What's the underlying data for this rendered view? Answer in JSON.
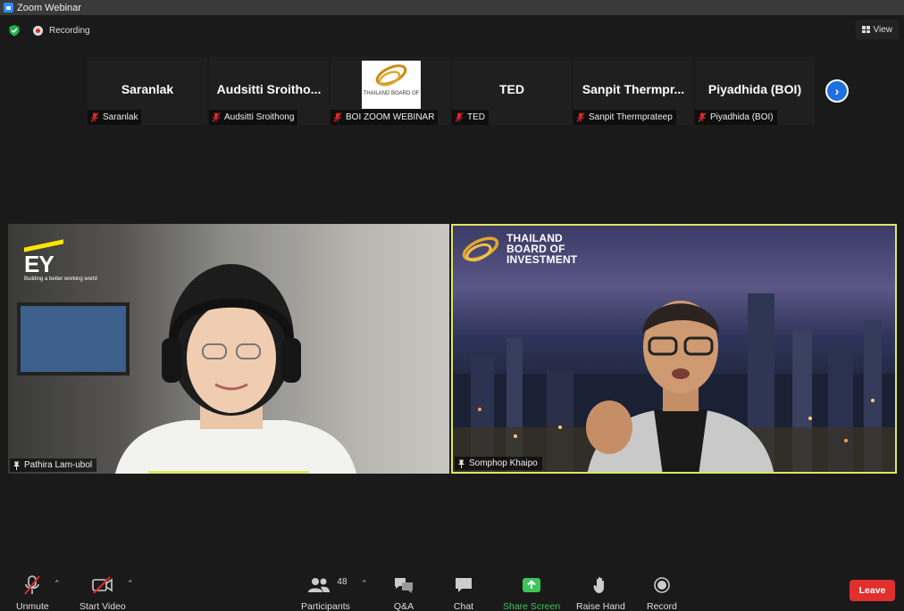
{
  "window": {
    "title": "Zoom Webinar"
  },
  "status": {
    "recording_label": "Recording",
    "view_label": "View"
  },
  "thumbnails": [
    {
      "display": "Saranlak",
      "label": "Saranlak"
    },
    {
      "display": "Audsitti  Sroitho...",
      "label": "Audsitti Sroithong"
    },
    {
      "display": "",
      "label": "BOI ZOOM WEBINAR",
      "logo_text": "THAILAND BOARD OF"
    },
    {
      "display": "TED",
      "label": "TED"
    },
    {
      "display": "Sanpit  Thermpr...",
      "label": "Sanpit Thermprateep"
    },
    {
      "display": "Piyadhida (BOI)",
      "label": "Piyadhida (BOI)"
    }
  ],
  "videos": {
    "left": {
      "name": "Pathira Lam-ubol",
      "ey_text": "EY",
      "ey_tagline": "Building a better working world"
    },
    "right": {
      "name": "Somphop Khaipo",
      "logo_line1": "THAILAND",
      "logo_line2": "BOARD OF",
      "logo_line3": "INVESTMENT"
    }
  },
  "toolbar": {
    "unmute": "Unmute",
    "start_video": "Start Video",
    "participants": "Participants",
    "participants_count": "48",
    "qa": "Q&A",
    "chat": "Chat",
    "share_screen": "Share Screen",
    "raise_hand": "Raise Hand",
    "record": "Record",
    "leave": "Leave"
  },
  "colors": {
    "accent_blue": "#2d8cff",
    "active_speaker": "#dde860",
    "share_green": "#3fc45a",
    "leave_red": "#e0302e",
    "mic_muted_red": "#e02828"
  },
  "icons": [
    "zoom-icon",
    "shield-icon",
    "recording-icon",
    "view-grid-icon",
    "mic-muted-icon",
    "chevron-right-icon",
    "pin-icon",
    "camera-off-icon",
    "participants-icon",
    "qa-icon",
    "chat-icon",
    "share-screen-icon",
    "hand-icon",
    "record-icon",
    "caret-up-icon"
  ]
}
